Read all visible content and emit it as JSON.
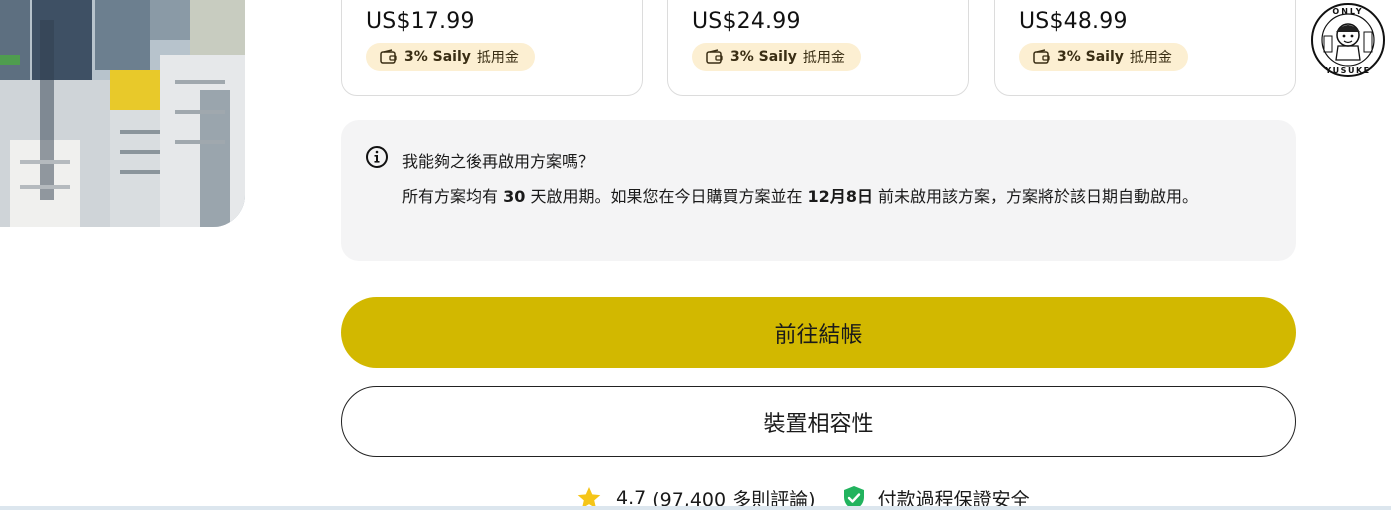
{
  "plans": [
    {
      "price": "US$17.99",
      "chip_pct": "3% Saily",
      "chip_label": "抵用金"
    },
    {
      "price": "US$24.99",
      "chip_pct": "3% Saily",
      "chip_label": "抵用金"
    },
    {
      "price": "US$48.99",
      "chip_pct": "3% Saily",
      "chip_label": "抵用金"
    }
  ],
  "faq": {
    "question": "我能夠之後再啟用方案嗎？",
    "answer_part1": "所有方案均有 ",
    "answer_days": "30",
    "answer_part2": " 天啟用期。如果您在今日購買方案並在 ",
    "answer_date": "12月8日",
    "answer_part3": " 前未啟用該方案，方案將於該日期自動啟用。"
  },
  "buttons": {
    "checkout": "前往結帳",
    "compatibility": "裝置相容性"
  },
  "rating": {
    "score": "4.7",
    "count": "(97,400 多則評論)",
    "secure_text": "付款過程保證安全"
  },
  "logo": {
    "text_top": "ONLY",
    "text_bottom": "YUSUKE"
  },
  "colors": {
    "primary_button": "#d2b800",
    "chip_bg": "#fcefd2",
    "info_bg": "#f4f4f5",
    "star": "#f5c518",
    "shield": "#22b35e"
  },
  "icons": {
    "info": "info-circle-icon",
    "wallet": "wallet-icon",
    "star": "star-icon",
    "shield": "shield-check-icon"
  }
}
